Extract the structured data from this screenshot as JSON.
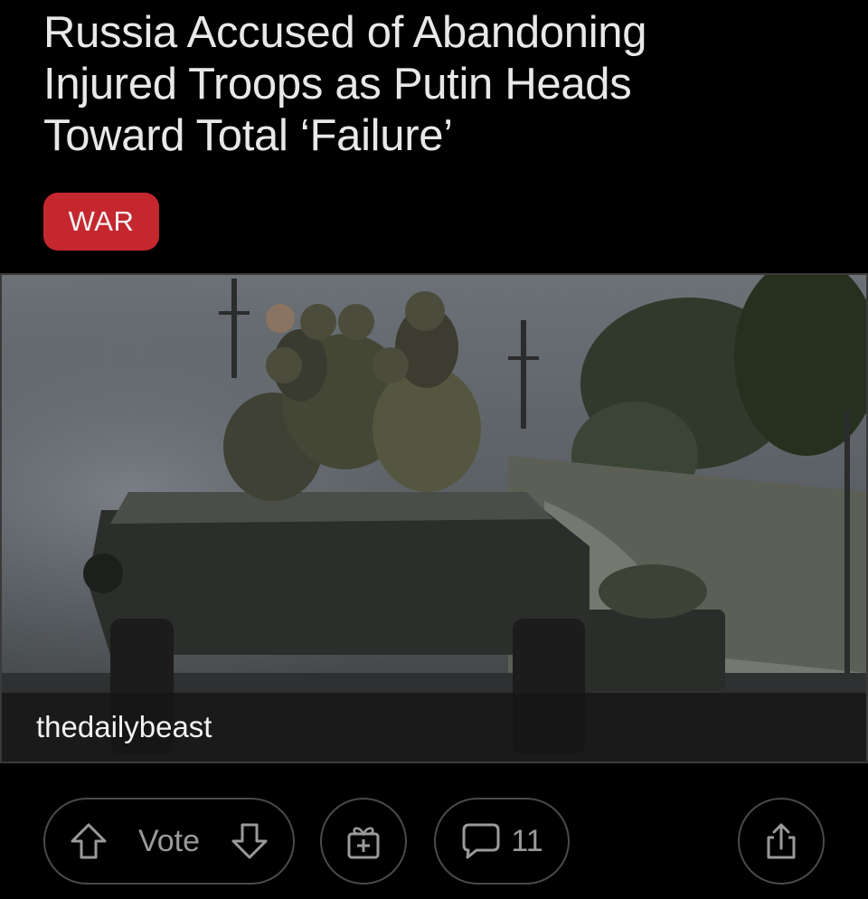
{
  "post": {
    "title_lines": [
      "Russia Accused of Abandoning",
      "Injured Troops as Putin Heads",
      "Toward Total ‘Failure’"
    ],
    "flair": "WAR"
  },
  "media": {
    "source": "thedailybeast",
    "icon": "photo-of-soldiers-on-armored-vehicle"
  },
  "actions": {
    "vote_label": "Vote",
    "comment_count": "11",
    "icons": [
      "upvote-arrow-icon",
      "downvote-arrow-icon",
      "award-gift-icon",
      "comment-bubble-icon",
      "share-icon"
    ]
  },
  "colors": {
    "background": "#000000",
    "flair_bg": "#c5272f",
    "muted": "#9a9a9a"
  }
}
